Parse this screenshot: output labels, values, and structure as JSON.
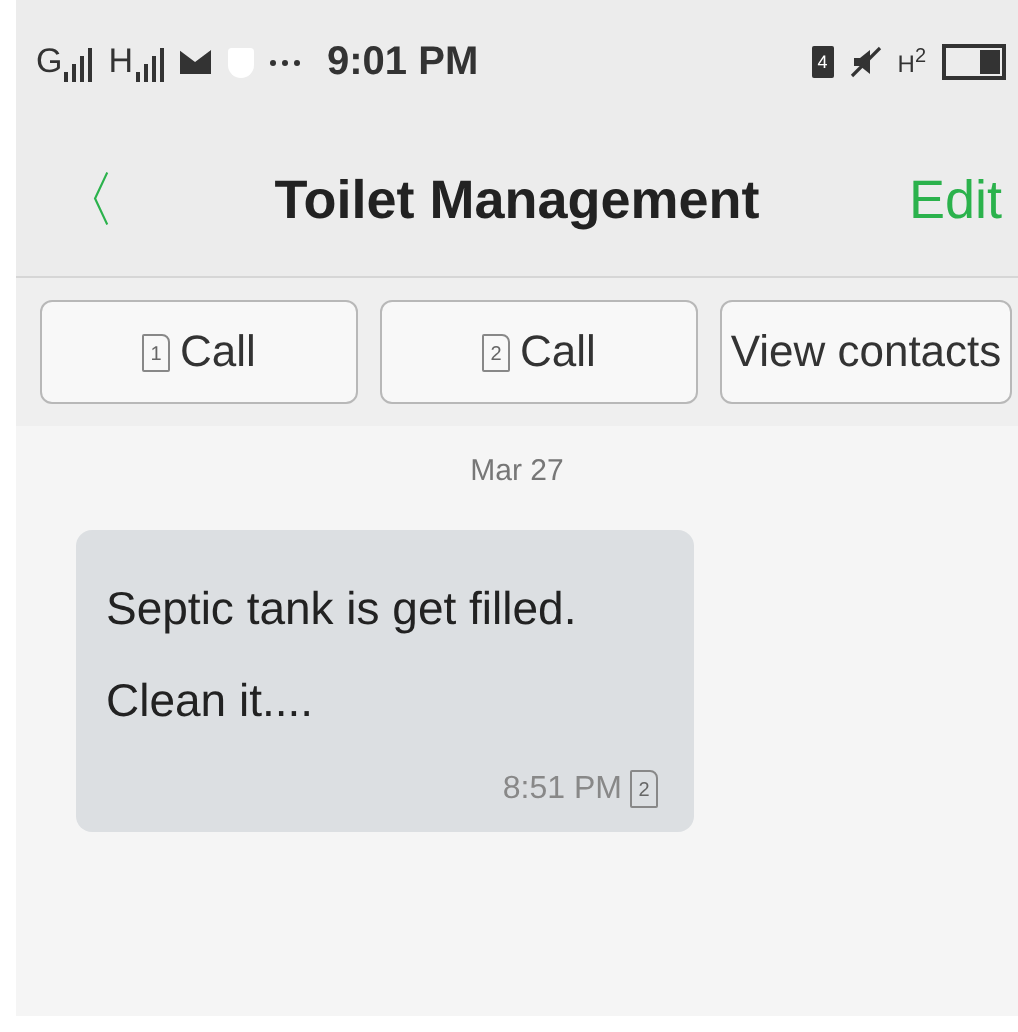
{
  "status_bar": {
    "network_1": "G",
    "network_2": "H",
    "time": "9:01 PM",
    "battery_badge": "4",
    "data": "H$^{2}$"
  },
  "header": {
    "back": "〈",
    "title": "Toilet Management",
    "action": "Edit"
  },
  "actions": [
    {
      "kind": "sim",
      "sim": "1",
      "label": "Call"
    },
    {
      "kind": "sim",
      "sim": "2",
      "label": "Call"
    },
    {
      "kind": "plain",
      "label": "View contacts"
    }
  ],
  "messages": [
    {
      "date": "Mar 27",
      "text": "Septic tank is get filled.\nClean it....",
      "time": "8:51 PM",
      "sim": "2"
    }
  ]
}
